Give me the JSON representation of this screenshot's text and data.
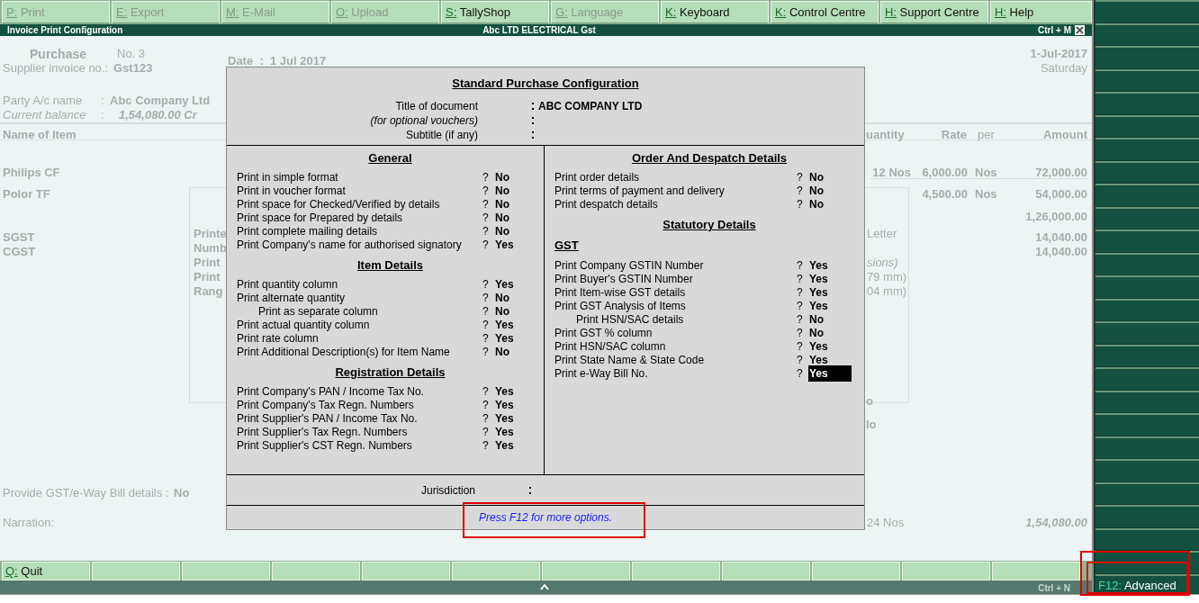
{
  "menu_bar": [
    {
      "key": "P:",
      "label": "Print",
      "disabled": true
    },
    {
      "key": "E:",
      "label": "Export",
      "disabled": true
    },
    {
      "key": "M:",
      "label": "E-Mail",
      "disabled": true
    },
    {
      "key": "O:",
      "label": "Upload",
      "disabled": true
    },
    {
      "key": "S:",
      "label": "TallyShop",
      "disabled": false
    },
    {
      "key": "G:",
      "label": "Language",
      "disabled": true
    },
    {
      "key": "K:",
      "label": "Keyboard",
      "disabled": false
    },
    {
      "key": "K:",
      "label": "Control Centre",
      "disabled": false
    },
    {
      "key": "H:",
      "label": "Support Centre",
      "disabled": false
    },
    {
      "key": "H:",
      "label": "Help",
      "disabled": false
    }
  ],
  "title_bar": {
    "title": "Invoice Print Configuration",
    "company": "Abc LTD ELECTRICAL Gst",
    "shortcut": "Ctrl + M"
  },
  "voucher": [
    {
      "text": "Purchase",
      "kind": "bold"
    },
    {
      "text": "No. 3",
      "kind": "plain"
    },
    {
      "text": "Supplier invoice no.:",
      "kind": "plain"
    },
    {
      "text": "Gst123",
      "kind": "bold"
    },
    {
      "text": "Date  :  1 Jul 2017",
      "kind": "bold"
    },
    {
      "text": "1-Jul-2017",
      "kind": "bold"
    },
    {
      "text": "Saturday",
      "kind": "plain"
    },
    {
      "text": "Party A/c name",
      "kind": "plain"
    },
    {
      "text": ":",
      "kind": "plain"
    },
    {
      "text": "Abc Company Ltd",
      "kind": "bold"
    },
    {
      "text": "Current balance",
      "kind": "italic"
    },
    {
      "text": ":",
      "kind": "plain"
    },
    {
      "text": "1,54,080.00 Cr",
      "kind": "bold-italic"
    },
    {
      "text": "Name of Item",
      "kind": "bold"
    },
    {
      "text": "uantity",
      "kind": "bold"
    },
    {
      "text": "Rate",
      "kind": "bold"
    },
    {
      "text": "per",
      "kind": "plain"
    },
    {
      "text": "Amount",
      "kind": "bold"
    },
    {
      "text": "Philips CF",
      "kind": "bold"
    },
    {
      "text": "12 Nos",
      "kind": "bold"
    },
    {
      "text": "6,000.00",
      "kind": "bold"
    },
    {
      "text": "Nos",
      "kind": "bold"
    },
    {
      "text": "72,000.00",
      "kind": "bold"
    },
    {
      "text": "Polor TF",
      "kind": "bold"
    },
    {
      "text": "4,500.00",
      "kind": "bold"
    },
    {
      "text": "Nos",
      "kind": "bold"
    },
    {
      "text": "54,000.00",
      "kind": "bold"
    },
    {
      "text": "1,26,000.00",
      "kind": "bold"
    },
    {
      "text": "SGST",
      "kind": "bold"
    },
    {
      "text": "CGST",
      "kind": "bold"
    },
    {
      "text": "14,040.00",
      "kind": "bold"
    },
    {
      "text": "14,040.00",
      "kind": "bold"
    },
    {
      "text": "Letter",
      "kind": "plain"
    },
    {
      "text": "sions)",
      "kind": "italic"
    },
    {
      "text": "79 mm)",
      "kind": "plain"
    },
    {
      "text": "04 mm)",
      "kind": "plain"
    },
    {
      "text": "o",
      "kind": "bold"
    },
    {
      "text": "lo",
      "kind": "bold"
    },
    {
      "text": "Provide GST/e-Way Bill details :",
      "kind": "plain"
    },
    {
      "text": "No",
      "kind": "bold"
    },
    {
      "text": "Narration:",
      "kind": "plain"
    },
    {
      "text": "24 Nos",
      "kind": "plain"
    },
    {
      "text": "1,54,080.00",
      "kind": "bold-italic"
    },
    {
      "text": "Printe",
      "kind": "bold"
    },
    {
      "text": "Numb",
      "kind": "bold"
    },
    {
      "text": "Print",
      "kind": "bold"
    },
    {
      "text": "Print",
      "kind": "bold"
    },
    {
      "text": "Rang",
      "kind": "bold"
    }
  ],
  "dialog": {
    "title": "Standard Purchase Configuration",
    "header_fields": [
      {
        "label": "Title of document",
        "value": "ABC COMPANY LTD",
        "kind": "plain"
      },
      {
        "label": "(for optional vouchers)",
        "kind": "italic"
      },
      {
        "label": "Subtitle (if any)",
        "kind": "plain"
      }
    ],
    "left_sections": [
      {
        "heading": "General",
        "options": [
          {
            "label": "Print in simple format",
            "prompt": "?",
            "value": "No",
            "indented": false,
            "selected": false
          },
          {
            "label": "Print in voucher format",
            "prompt": "?",
            "value": "No",
            "indented": false,
            "selected": false
          },
          {
            "label": "Print space for Checked/Verified by details",
            "prompt": "?",
            "value": "No",
            "indented": false,
            "selected": false
          },
          {
            "label": "Print space for Prepared by details",
            "prompt": "?",
            "value": "No",
            "indented": false,
            "selected": false
          },
          {
            "label": "Print complete mailing details",
            "prompt": "?",
            "value": "No",
            "indented": false,
            "selected": false
          },
          {
            "label": "Print Company's name for authorised signatory",
            "prompt": "?",
            "value": "Yes",
            "indented": false,
            "selected": false
          }
        ]
      },
      {
        "heading": "Item Details",
        "options": [
          {
            "label": "Print quantity column",
            "prompt": "?",
            "value": "Yes",
            "indented": false,
            "selected": false
          },
          {
            "label": "Print alternate quantity",
            "prompt": "?",
            "value": "No",
            "indented": false,
            "selected": false
          },
          {
            "label": "Print as separate column",
            "prompt": "?",
            "value": "No",
            "indented": true,
            "selected": false
          },
          {
            "label": "Print actual quantity column",
            "prompt": "?",
            "value": "Yes",
            "indented": false,
            "selected": false
          },
          {
            "label": "Print rate column",
            "prompt": "?",
            "value": "Yes",
            "indented": false,
            "selected": false
          },
          {
            "label": "Print Additional Description(s) for Item Name",
            "prompt": "?",
            "value": "No",
            "indented": false,
            "selected": false
          }
        ]
      },
      {
        "heading": "Registration Details",
        "options": [
          {
            "label": "Print Company's PAN / Income Tax No.",
            "prompt": "?",
            "value": "Yes",
            "indented": false,
            "selected": false
          },
          {
            "label": "Print Company's Tax Regn. Numbers",
            "prompt": "?",
            "value": "Yes",
            "indented": false,
            "selected": false
          },
          {
            "label": "Print Supplier's PAN / Income Tax No.",
            "prompt": "?",
            "value": "Yes",
            "indented": false,
            "selected": false
          },
          {
            "label": "Print Supplier's Tax Regn. Numbers",
            "prompt": "?",
            "value": "Yes",
            "indented": false,
            "selected": false
          },
          {
            "label": "Print Supplier's CST Regn. Numbers",
            "prompt": "?",
            "value": "Yes",
            "indented": false,
            "selected": false
          }
        ]
      }
    ],
    "right_sections": [
      {
        "heading": "Order And Despatch Details",
        "options": [
          {
            "label": "Print order details",
            "prompt": "?",
            "value": "No",
            "indented": false,
            "selected": false
          },
          {
            "label": "Print terms of payment and delivery",
            "prompt": "?",
            "value": "No",
            "indented": false,
            "selected": false
          },
          {
            "label": "Print despatch details",
            "prompt": "?",
            "value": "No",
            "indented": false,
            "selected": false
          }
        ]
      },
      {
        "heading": "Statutory Details",
        "subheading": "GST",
        "options": [
          {
            "label": "Print Company GSTIN Number",
            "prompt": "?",
            "value": "Yes",
            "indented": false,
            "selected": false
          },
          {
            "label": "Print Buyer's GSTIN Number",
            "prompt": "?",
            "value": "Yes",
            "indented": false,
            "selected": false
          },
          {
            "label": "Print Item-wise GST details",
            "prompt": "?",
            "value": "Yes",
            "indented": false,
            "selected": false
          },
          {
            "label": "Print GST Analysis of Items",
            "prompt": "?",
            "value": "Yes",
            "indented": false,
            "selected": false
          },
          {
            "label": "Print HSN/SAC details",
            "prompt": "?",
            "value": "No",
            "indented": true,
            "selected": false
          },
          {
            "label": "Print GST % column",
            "prompt": "?",
            "value": "No",
            "indented": false,
            "selected": false
          },
          {
            "label": "Print HSN/SAC column",
            "prompt": "?",
            "value": "Yes",
            "indented": false,
            "selected": false
          },
          {
            "label": "Print State Name & State Code",
            "prompt": "?",
            "value": "Yes",
            "indented": false,
            "selected": false
          },
          {
            "label": "Print e-Way Bill No.",
            "prompt": "?",
            "value": "Yes",
            "indented": false,
            "selected": true
          }
        ]
      }
    ],
    "jurisdiction_label": "Jurisdiction",
    "hint": {
      "text": "Press F12 for more options.",
      "highlighted": true
    }
  },
  "right_panel": {
    "button": {
      "key": "F12:",
      "label": "Advanced",
      "highlighted": true
    }
  },
  "bottom_bar": {
    "buttons": [
      {
        "key": "Q:",
        "label": "Quit"
      }
    ],
    "shortcut": "Ctrl + N"
  }
}
